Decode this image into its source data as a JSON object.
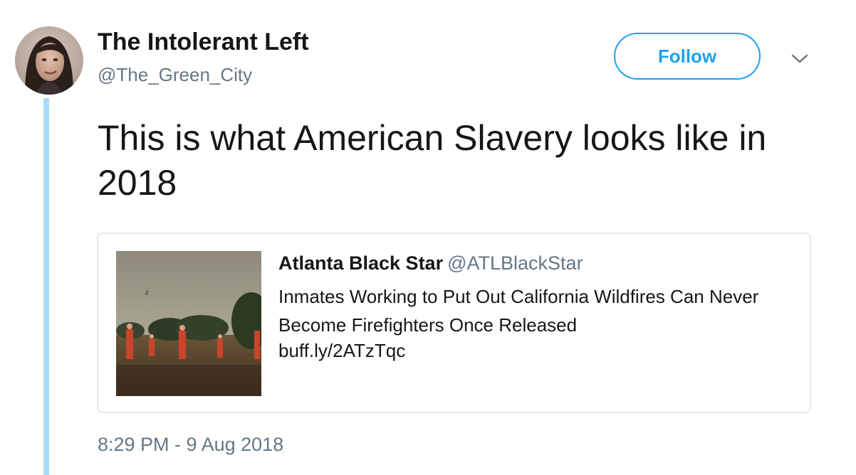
{
  "author": {
    "display_name": "The Intolerant Left",
    "handle": "@The_Green_City"
  },
  "follow_button": {
    "label": "Follow"
  },
  "menu": {
    "icon": "chevron-down-icon"
  },
  "tweet": {
    "text": "This is what American Slavery looks like in 2018",
    "timestamp": "8:29 PM - 9 Aug 2018"
  },
  "quoted_card": {
    "name": "Atlanta Black Star",
    "handle": "@ATLBlackStar",
    "text": "Inmates Working to Put Out California Wildfires Can Never Become Firefighters Once Released",
    "link": "buff.ly/2ATzTqc"
  },
  "colors": {
    "accent": "#1da1f2",
    "thread_line": "#a8dbf5",
    "secondary_text": "#657786",
    "primary_text": "#14171a",
    "card_border": "#e1e8ed"
  }
}
